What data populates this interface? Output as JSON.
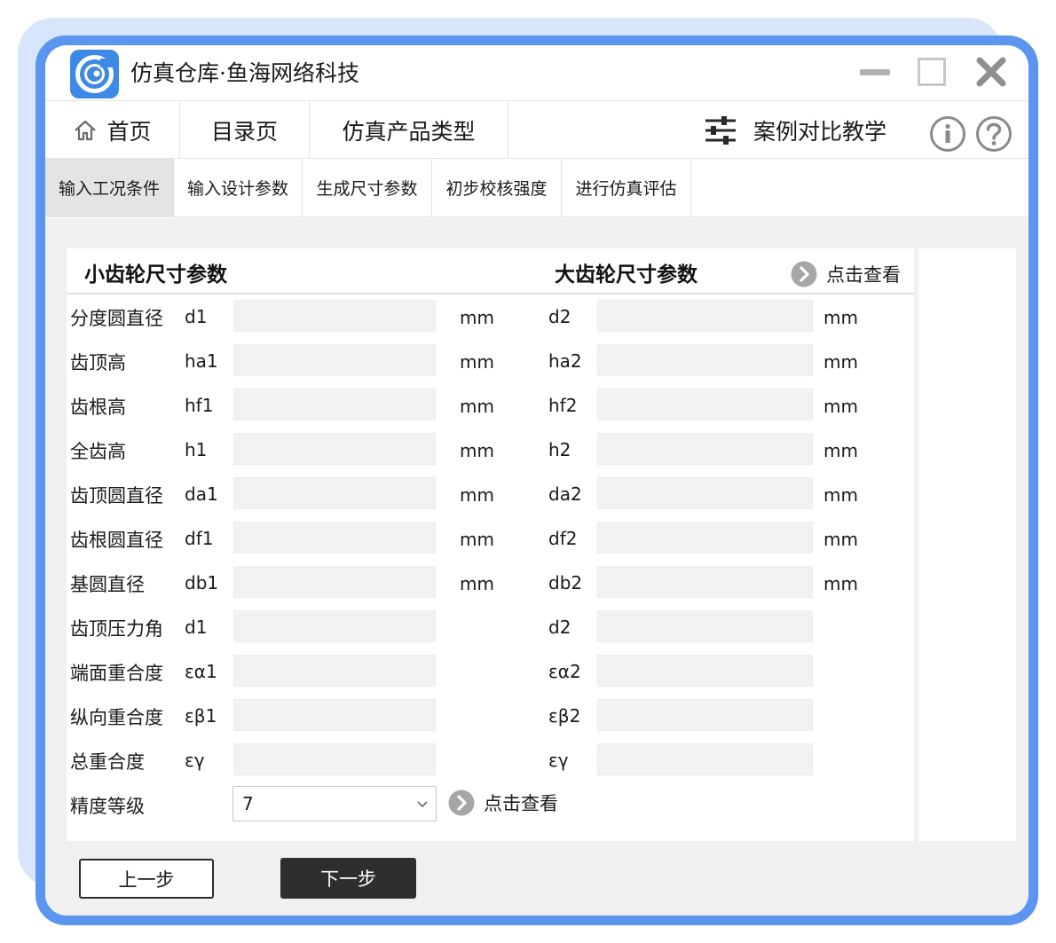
{
  "app": {
    "title": "仿真仓库·鱼海网络科技"
  },
  "nav": {
    "home": "首页",
    "catalog": "目录页",
    "product_types": "仿真产品类型",
    "case_compare": "案例对比教学"
  },
  "subtabs": [
    {
      "label": "输入工况条件",
      "active": true
    },
    {
      "label": "输入设计参数",
      "active": false
    },
    {
      "label": "生成尺寸参数",
      "active": false
    },
    {
      "label": "初步校核强度",
      "active": false
    },
    {
      "label": "进行仿真评估",
      "active": false
    }
  ],
  "panel": {
    "small_gear_title": "小齿轮尺寸参数",
    "large_gear_title": "大齿轮尺寸参数",
    "view_link": "点击查看"
  },
  "rows": [
    {
      "label": "分度圆直径",
      "sym1": "d1",
      "sym2": "d2",
      "unit": "mm",
      "value1": "",
      "value2": ""
    },
    {
      "label": "齿顶高",
      "sym1": "ha1",
      "sym2": "ha2",
      "unit": "mm",
      "value1": "",
      "value2": ""
    },
    {
      "label": "齿根高",
      "sym1": "hf1",
      "sym2": "hf2",
      "unit": "mm",
      "value1": "",
      "value2": ""
    },
    {
      "label": "全齿高",
      "sym1": "h1",
      "sym2": "h2",
      "unit": "mm",
      "value1": "",
      "value2": ""
    },
    {
      "label": "齿顶圆直径",
      "sym1": "da1",
      "sym2": "da2",
      "unit": "mm",
      "value1": "",
      "value2": ""
    },
    {
      "label": "齿根圆直径",
      "sym1": "df1",
      "sym2": "df2",
      "unit": "mm",
      "value1": "",
      "value2": ""
    },
    {
      "label": "基圆直径",
      "sym1": "db1",
      "sym2": "db2",
      "unit": "mm",
      "value1": "",
      "value2": ""
    },
    {
      "label": "齿顶压力角",
      "sym1": "d1",
      "sym2": "d2",
      "unit": "",
      "value1": "",
      "value2": ""
    },
    {
      "label": "端面重合度",
      "sym1": "εα1",
      "sym2": "εα2",
      "unit": "",
      "value1": "",
      "value2": ""
    },
    {
      "label": "纵向重合度",
      "sym1": "εβ1",
      "sym2": "εβ2",
      "unit": "",
      "value1": "",
      "value2": ""
    },
    {
      "label": "总重合度",
      "sym1": "εγ",
      "sym2": "εγ",
      "unit": "",
      "value1": "",
      "value2": ""
    }
  ],
  "precision": {
    "label": "精度等级",
    "selected": "7",
    "view_link": "点击查看"
  },
  "buttons": {
    "prev": "上一步",
    "next": "下一步"
  },
  "colors": {
    "frame": "#5b95f0",
    "frame_shadow": "#d7e6fb",
    "logo": "#3d8ae6",
    "next_button": "#2e2e2e"
  }
}
